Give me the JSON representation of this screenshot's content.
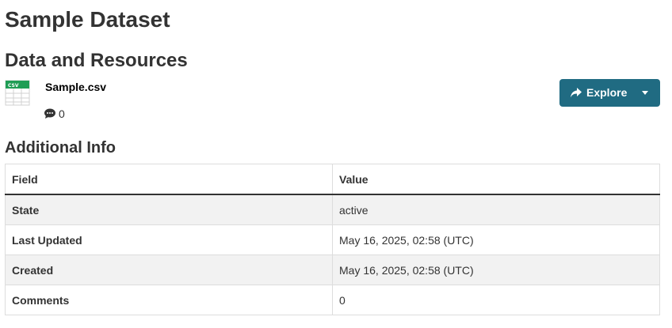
{
  "dataset": {
    "title": "Sample Dataset"
  },
  "resources_section": {
    "title": "Data and Resources",
    "items": [
      {
        "format_icon": "csv-file-icon",
        "format_label": "CSV",
        "name": "Sample.csv",
        "comment_icon": "comment-icon",
        "comment_count": "0",
        "explore_button": {
          "icon": "share-icon",
          "label": "Explore",
          "caret_icon": "caret-down-icon",
          "color": "#206b82"
        }
      }
    ]
  },
  "additional_info": {
    "title": "Additional Info",
    "columns": [
      "Field",
      "Value"
    ],
    "rows": [
      {
        "field": "State",
        "value": "active"
      },
      {
        "field": "Last Updated",
        "value": "May 16, 2025, 02:58 (UTC)"
      },
      {
        "field": "Created",
        "value": "May 16, 2025, 02:58 (UTC)"
      },
      {
        "field": "Comments",
        "value": "0"
      }
    ]
  },
  "colors": {
    "heading": "#333333",
    "csv_icon_green": "#1f9d55",
    "row_stripe": "#f2f2f2"
  }
}
